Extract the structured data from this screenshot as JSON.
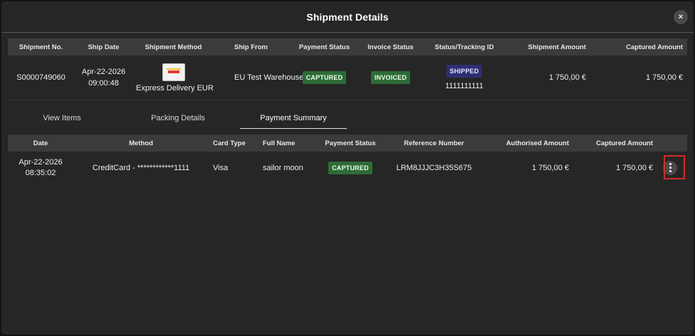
{
  "modal": {
    "title": "Shipment Details",
    "close_icon": "×"
  },
  "shipment_table": {
    "headers": [
      "Shipment No.",
      "Ship Date",
      "Shipment Method",
      "Ship From",
      "Payment Status",
      "Invoice Status",
      "Status/Tracking ID",
      "Shipment Amount",
      "Captured Amount"
    ],
    "row": {
      "shipment_no": "S0000749060",
      "ship_date_line1": "Apr-22-2026",
      "ship_date_line2": "09:00:48",
      "shipment_method": "Express Delivery EUR",
      "ship_from": "EU Test Warehouse",
      "payment_status": "CAPTURED",
      "invoice_status": "INVOICED",
      "status": "SHIPPED",
      "tracking_id": "1111111111",
      "shipment_amount": "1 750,00 €",
      "captured_amount": "1 750,00 €"
    }
  },
  "tabs": [
    {
      "label": "View Items",
      "active": false
    },
    {
      "label": "Packing Details",
      "active": false
    },
    {
      "label": "Payment Summary",
      "active": true
    }
  ],
  "payment_table": {
    "headers": [
      "Date",
      "Method",
      "Card Type",
      "Full Name",
      "Payment Status",
      "Reference Number",
      "Authorised Amount",
      "Captured Amount"
    ],
    "row": {
      "date_line1": "Apr-22-2026",
      "date_line2": "08:35:02",
      "method": "CreditCard - ************1111",
      "card_type": "Visa",
      "full_name": "sailor moon",
      "payment_status": "CAPTURED",
      "reference_number": "LRM8JJJC3H35S675",
      "authorised_amount": "1 750,00 €",
      "captured_amount": "1 750,00 €",
      "actions_icon": "more-vertical-icon"
    }
  },
  "colors": {
    "modal_bg": "#262626",
    "header_row_bg": "#3b3b3b",
    "badge_green": "#2e6b36",
    "badge_blue": "#2e2f72",
    "highlight": "#d42a2a"
  }
}
